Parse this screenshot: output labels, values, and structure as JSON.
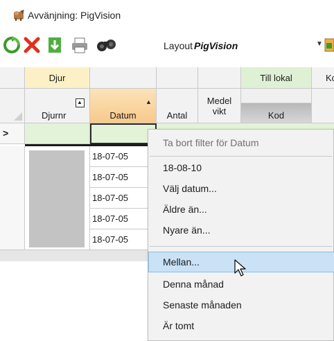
{
  "window": {
    "title": "Avvänjning: PigVision"
  },
  "toolbar": {
    "layout_label": "Layout",
    "layout_value": "PigVision",
    "icons": [
      "refresh-icon",
      "delete-icon",
      "import-icon",
      "print-icon",
      "binoculars-icon",
      "export-icon"
    ],
    "colors": {
      "refresh": "#3a9a2a",
      "delete": "#e0301e",
      "import": "#2e9a2e"
    }
  },
  "grid": {
    "group_headers": {
      "djur": "Djur",
      "till_lokal": "Till lokal",
      "next": "Ko"
    },
    "columns": {
      "djurnr": "Djurnr",
      "datum": "Datum",
      "antal": "Antal",
      "medelvikt": "Medel vikt",
      "kod": "Kod"
    },
    "current_row_marker": ">",
    "dates": [
      "18-07-05",
      "18-07-05",
      "18-07-05",
      "18-07-05",
      "18-07-05"
    ],
    "colors": {
      "datum_header": "#f8c98a",
      "filter_row": "#e2f3d8",
      "till_lokal": "#dff1d4",
      "djur": "#fcf1c6"
    }
  },
  "context_menu": {
    "items": [
      {
        "label": "Ta bort filter för Datum",
        "disabled": true
      },
      {
        "label": "18-08-10"
      },
      {
        "label": "Välj datum..."
      },
      {
        "label": "Äldre än..."
      },
      {
        "label": "Nyare än..."
      },
      {
        "label": "Mellan...",
        "hovered": true
      },
      {
        "label": "Denna månad"
      },
      {
        "label": "Senaste månaden"
      },
      {
        "label": "Är tomt"
      }
    ]
  }
}
